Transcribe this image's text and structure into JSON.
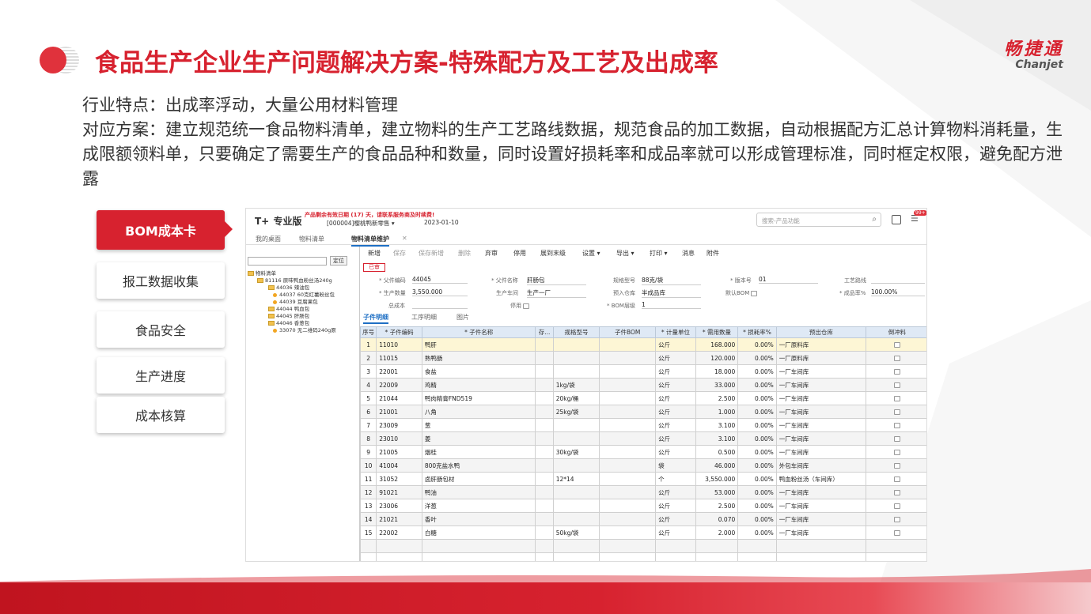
{
  "title": "食品生产企业生产问题解决方案-特殊配方及工艺及出成率",
  "logo": {
    "cn": "畅捷通",
    "en": "Chanjet"
  },
  "description": [
    "行业特点：出成率浮动，大量公用材料管理",
    "对应方案：建立规范统一食品物料清单，建立物料的生产工艺路线数据，规范食品的加工数据，自动根据配方汇总计算物料消耗量，生成限额领料单，只要确定了需要生产的食品品种和数量，同时设置好损耗率和成品率就可以形成管理标准，同时框定权限，避免配方泄露"
  ],
  "side_nav": [
    "BOM成本卡",
    "报工数据收集",
    "食品安全",
    "生产进度",
    "成本核算"
  ],
  "app": {
    "brand": "T+",
    "brand_suffix": "专业版",
    "warning": "产品剩余有效日期 (17) 天，请联系服务商及时续费!",
    "account": "[000004]樱桃鸭新零售 ▾",
    "date": "2023-01-10",
    "search_placeholder": "搜索-产品功能",
    "badge": "99+",
    "tabs": [
      "我的桌面",
      "物料清单",
      "物料清单维护"
    ],
    "tree": {
      "locate_btn": "定位",
      "nodes": [
        "物料清单",
        "81116 原味鸭血粉丝汤240g",
        "44036 辣油包",
        "44037 60克红薯粉丝包",
        "44039 豆腐果包",
        "44044 鸭血包",
        "44045 肝肠包",
        "44046 香葱包",
        "33070 无二维码240g原"
      ]
    },
    "toolbar": [
      "新增",
      "保存",
      "保存新增",
      "删除",
      "弃审",
      "停用",
      "展到末级",
      "设置 ▾",
      "导出 ▾",
      "打印 ▾",
      "消息",
      "附件"
    ],
    "stamp": "已审",
    "form": {
      "parent_code_label": "* 父件编码",
      "parent_code": "44045",
      "parent_name_label": "* 父件名称",
      "parent_name": "肝肠包",
      "spec_label": "规格型号",
      "spec": "88克/袋",
      "version_label": "* 版本号",
      "version": "01",
      "route_label": "工艺路线",
      "route": "",
      "qty_label": "* 生产数量",
      "qty": "3,550.000",
      "workshop_label": "生产车间",
      "workshop": "生产一厂",
      "warehouse_label": "预入仓库",
      "warehouse": "半成品库",
      "default_bom_label": "默认BOM",
      "yield_label": "* 成品率%",
      "yield": "100.00%",
      "total_cost_label": "总成本",
      "total_cost": "",
      "disable_label": "停用",
      "level_label": "* BOM层级",
      "level": "1"
    },
    "sub_tabs": [
      "子件明细",
      "工序明细",
      "图片"
    ],
    "grid_headers": [
      "序号",
      "* 子件编码",
      "* 子件名称",
      "存...",
      "规格型号",
      "子件BOM",
      "* 计量单位",
      "* 需用数量",
      "* 损耗率%",
      "预出仓库",
      "倒冲料"
    ],
    "rows": [
      [
        "1",
        "11010",
        "鸭肝",
        "",
        "",
        "",
        "公斤",
        "168.000",
        "0.00%",
        "一厂原料库"
      ],
      [
        "2",
        "11015",
        "熟鸭肠",
        "",
        "",
        "",
        "公斤",
        "120.000",
        "0.00%",
        "一厂原料库"
      ],
      [
        "3",
        "22001",
        "食盐",
        "",
        "",
        "",
        "公斤",
        "18.000",
        "0.00%",
        "一厂车间库"
      ],
      [
        "4",
        "22009",
        "鸡精",
        "",
        "1kg/袋",
        "",
        "公斤",
        "33.000",
        "0.00%",
        "一厂车间库"
      ],
      [
        "5",
        "21044",
        "鸭肉精膏FND519",
        "",
        "20kg/桶",
        "",
        "公斤",
        "2.500",
        "0.00%",
        "一厂车间库"
      ],
      [
        "6",
        "21001",
        "八角",
        "",
        "25kg/袋",
        "",
        "公斤",
        "1.000",
        "0.00%",
        "一厂车间库"
      ],
      [
        "7",
        "23009",
        "葱",
        "",
        "",
        "",
        "公斤",
        "3.100",
        "0.00%",
        "一厂车间库"
      ],
      [
        "8",
        "23010",
        "姜",
        "",
        "",
        "",
        "公斤",
        "3.100",
        "0.00%",
        "一厂车间库"
      ],
      [
        "9",
        "21005",
        "烟桂",
        "",
        "30kg/袋",
        "",
        "公斤",
        "0.500",
        "0.00%",
        "一厂车间库"
      ],
      [
        "10",
        "41004",
        "800克盐水鸭",
        "",
        "",
        "",
        "袋",
        "46.000",
        "0.00%",
        "外包车间库"
      ],
      [
        "11",
        "31052",
        "卤肝肠包材",
        "",
        "12*14",
        "",
        "个",
        "3,550.000",
        "0.00%",
        "鸭血粉丝汤（车间库）"
      ],
      [
        "12",
        "91021",
        "鸭油",
        "",
        "",
        "",
        "公斤",
        "53.000",
        "0.00%",
        "一厂车间库"
      ],
      [
        "13",
        "23006",
        "洋葱",
        "",
        "",
        "",
        "公斤",
        "2.500",
        "0.00%",
        "一厂车间库"
      ],
      [
        "14",
        "21021",
        "香叶",
        "",
        "",
        "",
        "公斤",
        "0.070",
        "0.00%",
        "一厂车间库"
      ],
      [
        "15",
        "22002",
        "白糖",
        "",
        "50kg/袋",
        "",
        "公斤",
        "2.000",
        "0.00%",
        "一厂车间库"
      ]
    ]
  }
}
